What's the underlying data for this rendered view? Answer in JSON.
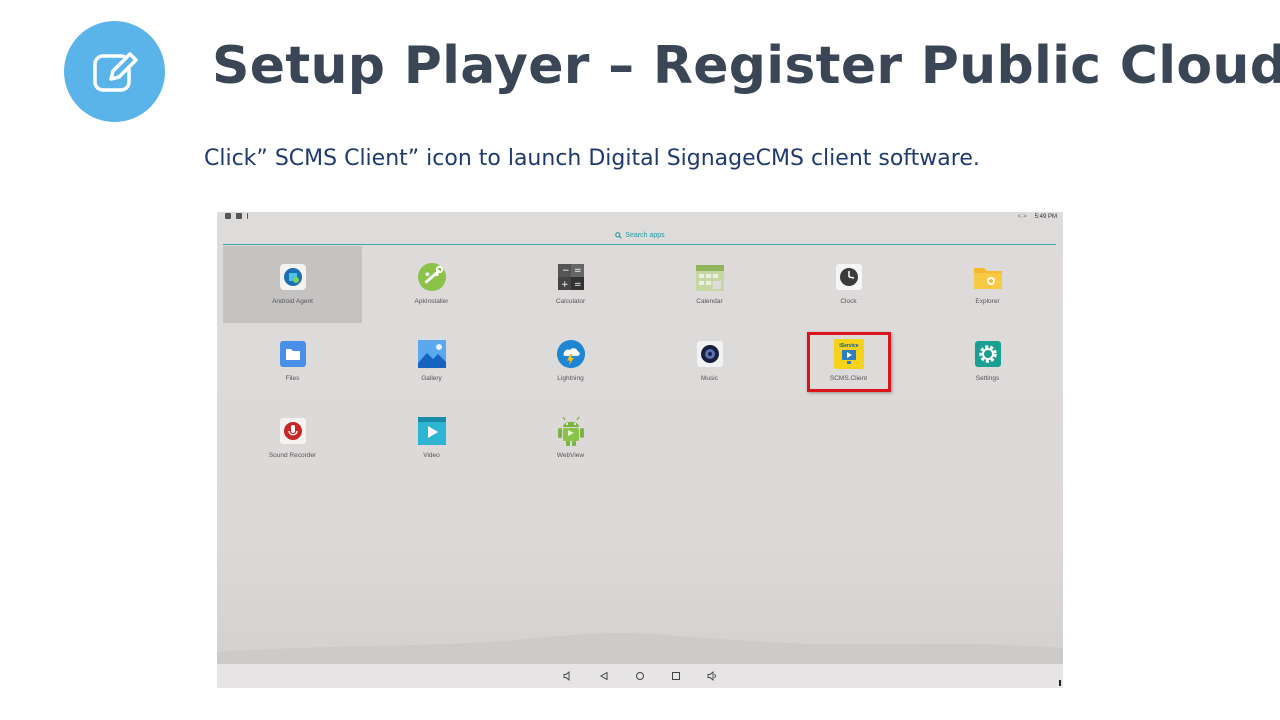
{
  "slide": {
    "title": "Setup Player – Register Public Cloud",
    "instruction": "Click” SCMS Client” icon to launch Digital SignageCMS client software.",
    "badge_icon": "edit-icon",
    "colors": {
      "badge": "#5ab4ea",
      "title": "#3a4556",
      "instruction": "#1f3a6e",
      "highlight": "#d9141c"
    }
  },
  "device": {
    "status_bar": {
      "time": "5:49 PM"
    },
    "search": {
      "placeholder": "Search apps"
    },
    "apps": [
      {
        "label": "Android Agent",
        "icon": "android-agent-icon",
        "selected": true
      },
      {
        "label": "ApkInstaller",
        "icon": "apkinstaller-icon"
      },
      {
        "label": "Calculator",
        "icon": "calculator-icon"
      },
      {
        "label": "Calendar",
        "icon": "calendar-icon"
      },
      {
        "label": "Clock",
        "icon": "clock-icon"
      },
      {
        "label": "Explorer",
        "icon": "explorer-icon"
      },
      {
        "label": "Files",
        "icon": "files-icon"
      },
      {
        "label": "Gallery",
        "icon": "gallery-icon"
      },
      {
        "label": "Lightning",
        "icon": "lightning-icon"
      },
      {
        "label": "Music",
        "icon": "music-icon"
      },
      {
        "label": "SCMS.Client",
        "icon": "scms-client-icon",
        "icon_text": "iService",
        "highlighted": true
      },
      {
        "label": "Settings",
        "icon": "settings-icon"
      },
      {
        "label": "Sound Recorder",
        "icon": "sound-recorder-icon"
      },
      {
        "label": "Video",
        "icon": "video-icon"
      },
      {
        "label": "WebView",
        "icon": "webview-icon"
      }
    ],
    "nav_bar": [
      "volume-down-icon",
      "back-icon",
      "home-icon",
      "recents-icon",
      "volume-up-icon"
    ]
  }
}
